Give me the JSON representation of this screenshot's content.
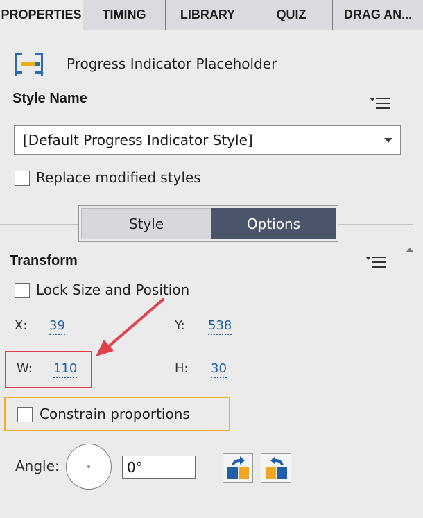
{
  "tabs": [
    {
      "label": "PROPERTIES",
      "active": true
    },
    {
      "label": "TIMING",
      "active": false
    },
    {
      "label": "LIBRARY",
      "active": false
    },
    {
      "label": "QUIZ",
      "active": false
    },
    {
      "label": "DRAG AN...",
      "active": false
    }
  ],
  "object": {
    "icon": "progress-indicator-icon",
    "name": "Progress Indicator Placeholder"
  },
  "style": {
    "title": "Style Name",
    "selected": "[Default Progress Indicator Style]",
    "replace_label": "Replace modified styles",
    "replace_checked": false
  },
  "segmented": {
    "style_label": "Style",
    "options_label": "Options",
    "selected": "Options"
  },
  "transform": {
    "title": "Transform",
    "lock_label": "Lock Size and Position",
    "lock_checked": false,
    "x_label": "X:",
    "x": "39",
    "y_label": "Y:",
    "y": "538",
    "w_label": "W:",
    "w": "110",
    "h_label": "H:",
    "h": "30",
    "constrain_label": "Constrain proportions",
    "constrain_checked": false,
    "angle_label": "Angle:",
    "angle": "0°"
  },
  "colors": {
    "accent_blue": "#1f5fa8",
    "options_bg": "#4b5468",
    "annotation_red": "#e0404a",
    "annotation_orange": "#f0b02a",
    "icon_gold": "#f0a623"
  }
}
